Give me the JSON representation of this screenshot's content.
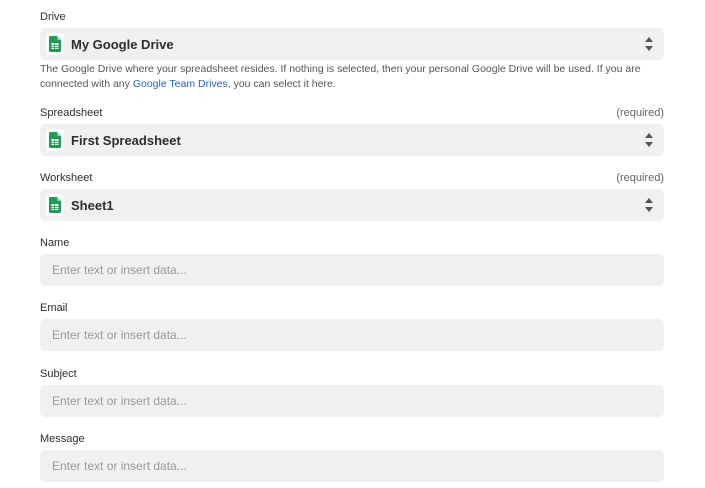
{
  "drive": {
    "label": "Drive",
    "value": "My Google Drive",
    "help_before": "The Google Drive where your spreadsheet resides. If nothing is selected, then your personal Google Drive will be used. If you are connected with any ",
    "help_link": "Google Team Drives",
    "help_after": ", you can select it here."
  },
  "spreadsheet": {
    "label": "Spreadsheet",
    "required": "(required)",
    "value": "First Spreadsheet"
  },
  "worksheet": {
    "label": "Worksheet",
    "required": "(required)",
    "value": "Sheet1"
  },
  "name": {
    "label": "Name",
    "placeholder": "Enter text or insert data..."
  },
  "email": {
    "label": "Email",
    "placeholder": "Enter text or insert data..."
  },
  "subject": {
    "label": "Subject",
    "placeholder": "Enter text or insert data..."
  },
  "message": {
    "label": "Message",
    "placeholder": "Enter text or insert data..."
  },
  "colors": {
    "sheets_green": "#1f9d55",
    "link_blue": "#1a63d6",
    "field_bg": "#f0f0f0"
  },
  "icons": {
    "select_icon": "google-sheets-icon",
    "select_arrow": "chevron-up-down-icon"
  }
}
